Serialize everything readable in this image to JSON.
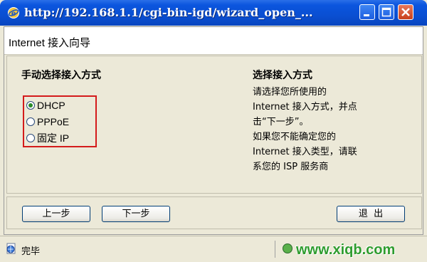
{
  "window": {
    "title": "http://192.168.1.1/cgi-bin-igd/wizard_open_..."
  },
  "header": {
    "title": "Internet 接入向导"
  },
  "left_section": {
    "heading": "手动选择接入方式",
    "options": [
      {
        "label": "DHCP",
        "selected": true
      },
      {
        "label": "PPPoE",
        "selected": false
      },
      {
        "label": "固定 IP",
        "selected": false
      }
    ]
  },
  "right_section": {
    "heading": "选择接入方式",
    "description_lines": [
      "请选择您所使用的",
      "Internet 接入方式，并点",
      "击“下一步”。",
      "如果您不能确定您的",
      "Internet 接入类型，请联",
      "系您的 ISP 服务商"
    ]
  },
  "buttons": {
    "prev": "上一步",
    "next": "下一步",
    "exit": "退  出"
  },
  "status": {
    "text": "完毕"
  },
  "watermark": "www.xiqb.com",
  "colors": {
    "titlebar": "#0a4fd2",
    "highlight_box": "#d41b1b",
    "watermark": "#2e9c2e",
    "background": "#ece9d8"
  }
}
